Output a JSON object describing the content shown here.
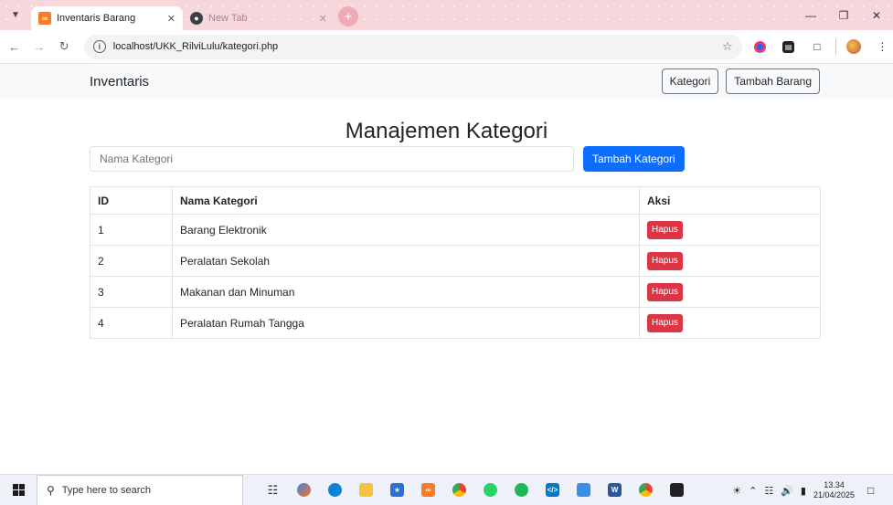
{
  "browser": {
    "tabs": [
      {
        "title": "Inventaris Barang",
        "active": true,
        "favicon": "xampp-icon"
      },
      {
        "title": "New Tab",
        "active": false,
        "favicon": "globe-icon"
      }
    ],
    "url": "localhost/UKK_RilviLulu/kategori.php"
  },
  "navbar": {
    "brand": "Inventaris",
    "buttons": [
      {
        "label": "Kategori"
      },
      {
        "label": "Tambah Barang"
      }
    ]
  },
  "main": {
    "title": "Manajemen Kategori",
    "input_placeholder": "Nama Kategori",
    "add_button": "Tambah Kategori",
    "table": {
      "headers": [
        "ID",
        "Nama Kategori",
        "Aksi"
      ],
      "rows": [
        {
          "id": "1",
          "name": "Barang Elektronik",
          "action": "Hapus"
        },
        {
          "id": "2",
          "name": "Peralatan Sekolah",
          "action": "Hapus"
        },
        {
          "id": "3",
          "name": "Makanan dan Minuman",
          "action": "Hapus"
        },
        {
          "id": "4",
          "name": "Peralatan Rumah Tangga",
          "action": "Hapus"
        }
      ]
    }
  },
  "taskbar": {
    "search_placeholder": "Type here to search",
    "time": "13.34",
    "date": "21/04/2025"
  },
  "colors": {
    "primary": "#0d6efd",
    "danger": "#dc3545",
    "tabstrip": "#f6d7dc"
  }
}
